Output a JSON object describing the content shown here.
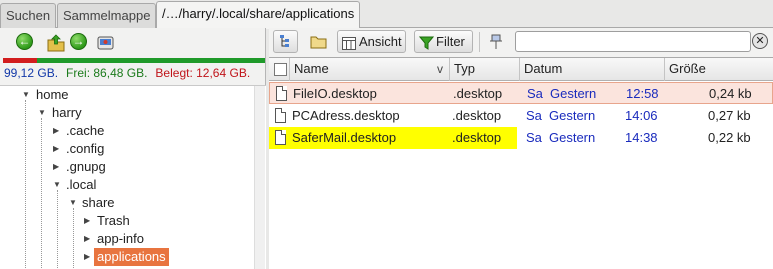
{
  "tabs": [
    {
      "label": "Suchen"
    },
    {
      "label": "Sammelmappe"
    },
    {
      "label": "/…/harry/.local/share/applications"
    }
  ],
  "left_toolbar": {
    "icons": [
      "back-icon",
      "folder-up-icon",
      "forward-icon",
      "drive-icon"
    ]
  },
  "disk": {
    "total": "99,12 GB.",
    "free": "Frei: 86,48 GB.",
    "used": "Belegt: 12,64 GB.",
    "used_fraction": 0.128,
    "colors": {
      "used": "#d21d1d",
      "free": "#1f9a2a"
    }
  },
  "tree": {
    "nodes": [
      {
        "label": "home",
        "expanded": true
      },
      {
        "label": "harry",
        "expanded": true
      },
      {
        "label": ".cache",
        "expanded": false
      },
      {
        "label": ".config",
        "expanded": false
      },
      {
        "label": ".gnupg",
        "expanded": false
      },
      {
        "label": ".local",
        "expanded": true
      },
      {
        "label": "share",
        "expanded": true
      },
      {
        "label": "Trash",
        "expanded": false
      },
      {
        "label": "app-info",
        "expanded": false
      },
      {
        "label": "applications",
        "expanded": false,
        "selected": true
      }
    ]
  },
  "right_toolbar": {
    "view_label": "Ansicht",
    "filter_label": "Filter",
    "search_value": "",
    "icons": [
      "tree-toggle-icon",
      "folder-icon",
      "view-icon",
      "funnel-icon",
      "pin-icon",
      "clear-icon"
    ]
  },
  "table": {
    "columns": [
      "Name",
      "Typ",
      "Datum",
      "Größe"
    ],
    "sort_indicator": "v",
    "rows": [
      {
        "name": "FileIO.desktop",
        "type": ".desktop",
        "day": "Sa",
        "date": "Gestern",
        "time": "12:58",
        "size": "0,24 kb"
      },
      {
        "name": "PCAdress.desktop",
        "type": ".desktop",
        "day": "Sa",
        "date": "Gestern",
        "time": "14:06",
        "size": "0,27 kb"
      },
      {
        "name": "SaferMail.desktop",
        "type": ".desktop",
        "day": "Sa",
        "date": "Gestern",
        "time": "14:38",
        "size": "0,22 kb"
      }
    ],
    "colors": {
      "current_row": "#fbe4dd",
      "current_border": "#e8a58c",
      "highlight": "#ffff00",
      "selected_node": "#e8743f"
    }
  }
}
